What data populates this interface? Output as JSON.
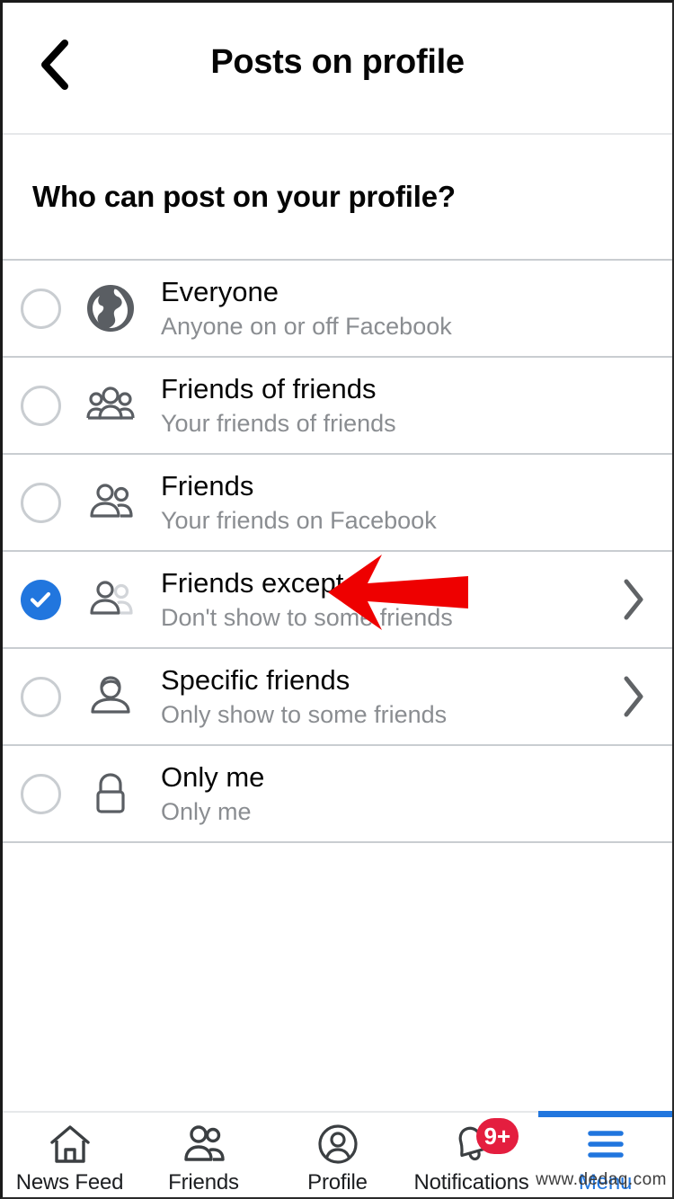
{
  "header": {
    "back_icon": "chevron-left-icon",
    "title": "Posts on profile"
  },
  "question": {
    "text": "Who can post on your profile?"
  },
  "options": [
    {
      "id": "everyone",
      "title": "Everyone",
      "subtitle": "Anyone on or off Facebook",
      "icon": "globe-icon",
      "selected": false,
      "has_chevron": false
    },
    {
      "id": "friends-of-friends",
      "title": "Friends of friends",
      "subtitle": "Your friends of friends",
      "icon": "people-group-icon",
      "selected": false,
      "has_chevron": false
    },
    {
      "id": "friends",
      "title": "Friends",
      "subtitle": "Your friends on Facebook",
      "icon": "two-people-icon",
      "selected": false,
      "has_chevron": false
    },
    {
      "id": "friends-except",
      "title": "Friends except...",
      "subtitle": "Don't show to some friends",
      "icon": "two-people-faded-icon",
      "selected": true,
      "has_chevron": true
    },
    {
      "id": "specific-friends",
      "title": "Specific friends",
      "subtitle": "Only show to some friends",
      "icon": "person-icon",
      "selected": false,
      "has_chevron": true
    },
    {
      "id": "only-me",
      "title": "Only me",
      "subtitle": "Only me",
      "icon": "lock-icon",
      "selected": false,
      "has_chevron": false
    }
  ],
  "annotation": {
    "type": "red-arrow-pointing-left",
    "color": "#ee0000",
    "target": "friends-except"
  },
  "tabbar": {
    "tabs": [
      {
        "id": "news-feed",
        "label": "News Feed",
        "icon": "home-icon",
        "active": false,
        "badge": ""
      },
      {
        "id": "friends",
        "label": "Friends",
        "icon": "friends-icon",
        "active": false,
        "badge": ""
      },
      {
        "id": "profile",
        "label": "Profile",
        "icon": "profile-circle-icon",
        "active": false,
        "badge": ""
      },
      {
        "id": "notifications",
        "label": "Notifications",
        "icon": "bell-icon",
        "active": false,
        "badge": "9+"
      },
      {
        "id": "menu",
        "label": "Menu",
        "icon": "hamburger-icon",
        "active": true,
        "badge": ""
      }
    ],
    "active_color": "#2176de",
    "badge_color": "#e41e3f"
  },
  "watermark": {
    "text": "www.dedaq.com"
  }
}
